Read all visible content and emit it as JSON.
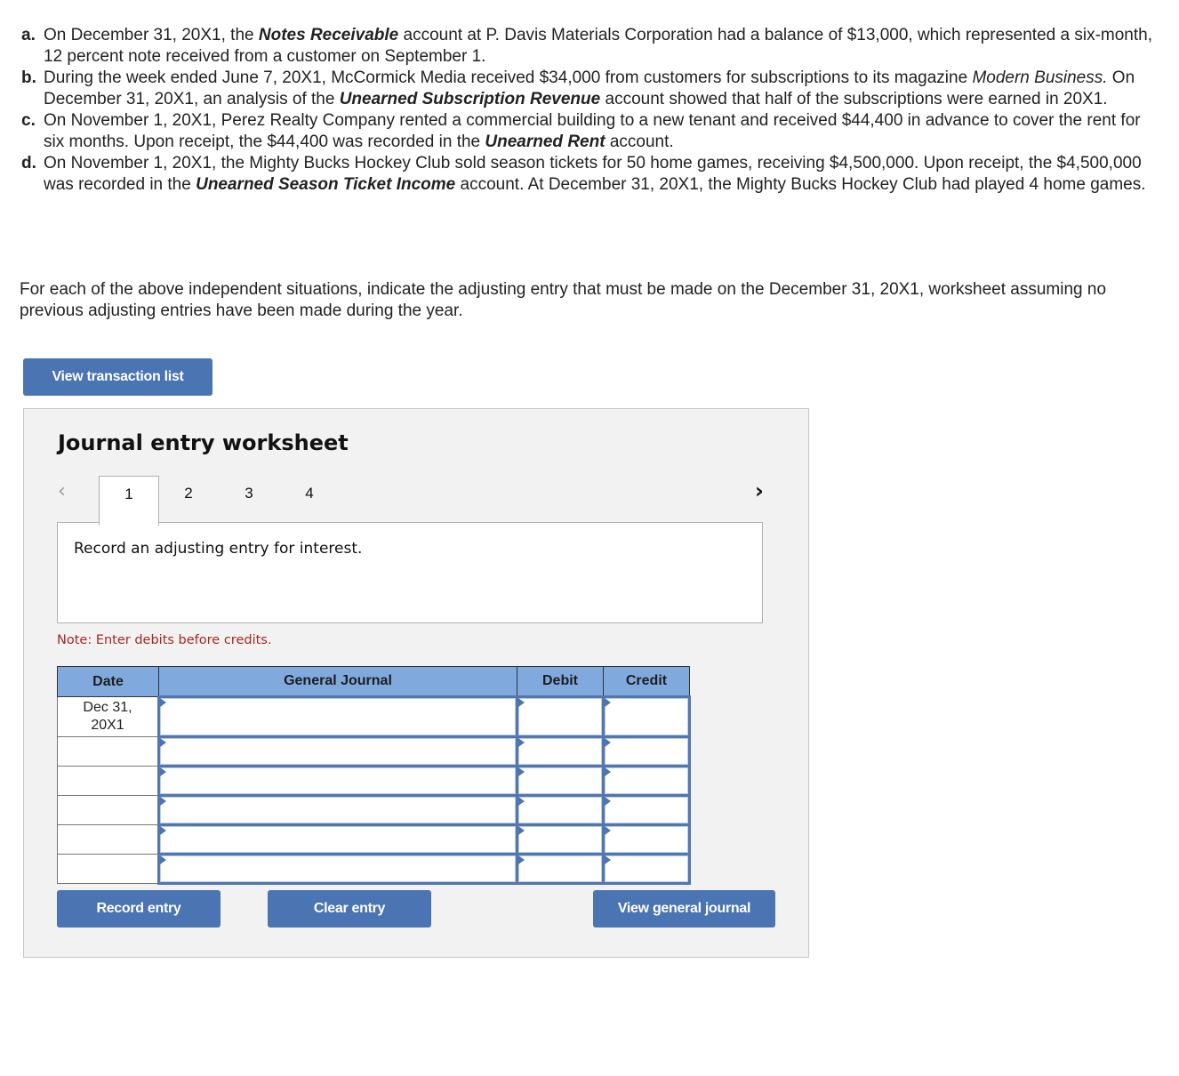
{
  "problems": [
    {
      "letter": "a.",
      "parts": [
        {
          "t": "On December 31, 20X1, the ",
          "s": "normal"
        },
        {
          "t": "Notes Receivable",
          "s": "bold-italic"
        },
        {
          "t": " account at P. Davis Materials Corporation had a balance of $13,000, which represented a six-month, 12 percent note received from a customer on September 1.",
          "s": "normal"
        }
      ]
    },
    {
      "letter": "b.",
      "parts": [
        {
          "t": "During the week ended June 7, 20X1, McCormick Media received $34,000 from customers for subscriptions to its magazine ",
          "s": "normal"
        },
        {
          "t": "Modern Business.",
          "s": "italic"
        },
        {
          "t": " On December 31, 20X1, an analysis of the ",
          "s": "normal"
        },
        {
          "t": "Unearned Subscription Revenue",
          "s": "bold-italic"
        },
        {
          "t": " account showed that half of the subscriptions were earned in 20X1.",
          "s": "normal"
        }
      ]
    },
    {
      "letter": "c.",
      "parts": [
        {
          "t": "On November 1, 20X1, Perez Realty Company rented a commercial building to a new tenant and received $44,400 in advance to cover the rent for six months. Upon receipt, the $44,400 was recorded in the ",
          "s": "normal"
        },
        {
          "t": "Unearned Rent",
          "s": "bold-italic"
        },
        {
          "t": " account.",
          "s": "normal"
        }
      ]
    },
    {
      "letter": "d.",
      "parts": [
        {
          "t": "On November 1, 20X1, the Mighty Bucks Hockey Club sold season tickets for 50 home games, receiving $4,500,000. Upon receipt, the $4,500,000 was recorded in the ",
          "s": "normal"
        },
        {
          "t": "Unearned Season Ticket Income",
          "s": "bold-italic"
        },
        {
          "t": " account. At December 31, 20X1, the Mighty Bucks Hockey Club had played 4 home games.",
          "s": "normal"
        }
      ]
    }
  ],
  "instructions": "For each of the above independent situations, indicate the adjusting entry that must be made on the December 31, 20X1, worksheet assuming no previous adjusting entries have been made during the year.",
  "view_transaction_list_label": "View transaction list",
  "worksheet": {
    "title": "Journal entry worksheet",
    "prev_icon": "‹",
    "next_icon": "›",
    "tabs": [
      "1",
      "2",
      "3",
      "4"
    ],
    "active_tab": "1",
    "prompt": "Record an adjusting entry for interest.",
    "note": "Note: Enter debits before credits.",
    "columns": {
      "date": "Date",
      "general_journal": "General Journal",
      "debit": "Debit",
      "credit": "Credit"
    },
    "rows": [
      {
        "date": "Dec 31, 20X1",
        "account": "",
        "debit": "",
        "credit": ""
      },
      {
        "date": "",
        "account": "",
        "debit": "",
        "credit": ""
      },
      {
        "date": "",
        "account": "",
        "debit": "",
        "credit": ""
      },
      {
        "date": "",
        "account": "",
        "debit": "",
        "credit": ""
      },
      {
        "date": "",
        "account": "",
        "debit": "",
        "credit": ""
      },
      {
        "date": "",
        "account": "",
        "debit": "",
        "credit": ""
      }
    ],
    "buttons": {
      "record": "Record entry",
      "clear": "Clear entry",
      "view_journal": "View general journal"
    }
  },
  "colors": {
    "button": "#4a74b2",
    "header": "#80a9dd",
    "note": "#a8281f",
    "panel": "#f2f2f2"
  }
}
